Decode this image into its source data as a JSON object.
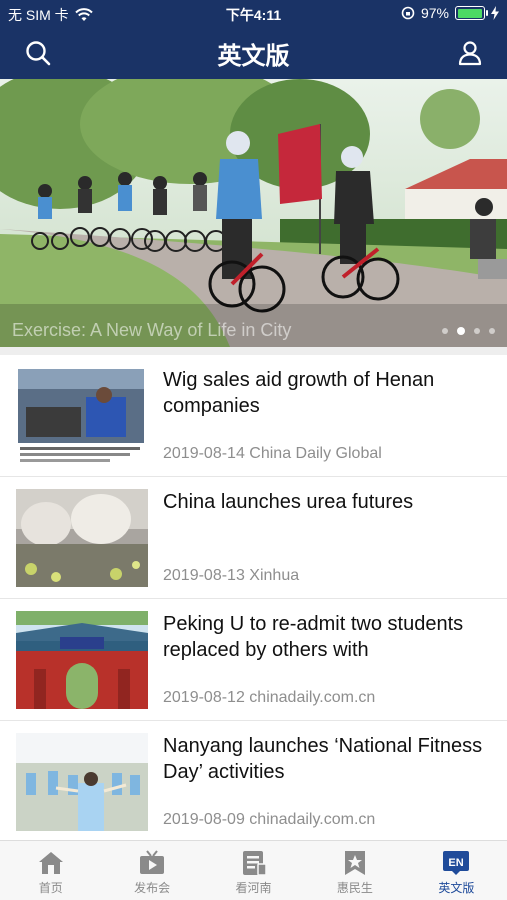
{
  "status_bar": {
    "carrier": "无 SIM 卡",
    "time": "下午4:11",
    "battery_percent": "97%",
    "battery_level": 0.97
  },
  "nav": {
    "title": "英文版"
  },
  "hero": {
    "caption": "Exercise: A New Way of Life in City",
    "slide_count": 4,
    "active_slide": 2
  },
  "articles": [
    {
      "title": "Wig sales aid growth of Henan companies",
      "date": "2019-08-14",
      "source": "China Daily Global"
    },
    {
      "title": "China launches urea futures",
      "date": "2019-08-13",
      "source": "Xinhua"
    },
    {
      "title": "Peking U to re-admit two students replaced by others with",
      "date": "2019-08-12",
      "source": "chinadaily.com.cn"
    },
    {
      "title": "Nanyang launches ‘National Fitness Day’ activities",
      "date": "2019-08-09",
      "source": "chinadaily.com.cn"
    }
  ],
  "tabs": [
    {
      "label": "首页",
      "icon": "home-icon"
    },
    {
      "label": "发布会",
      "icon": "tv-icon"
    },
    {
      "label": "看河南",
      "icon": "document-icon"
    },
    {
      "label": "惠民生",
      "icon": "star-bookmark-icon"
    },
    {
      "label": "英文版",
      "icon": "en-icon",
      "badge": "EN",
      "active": true
    }
  ],
  "colors": {
    "header": "#1a3366",
    "tab_active": "#1f4b9a",
    "tab_inactive": "#8a8a8a",
    "battery": "#4cd964"
  }
}
